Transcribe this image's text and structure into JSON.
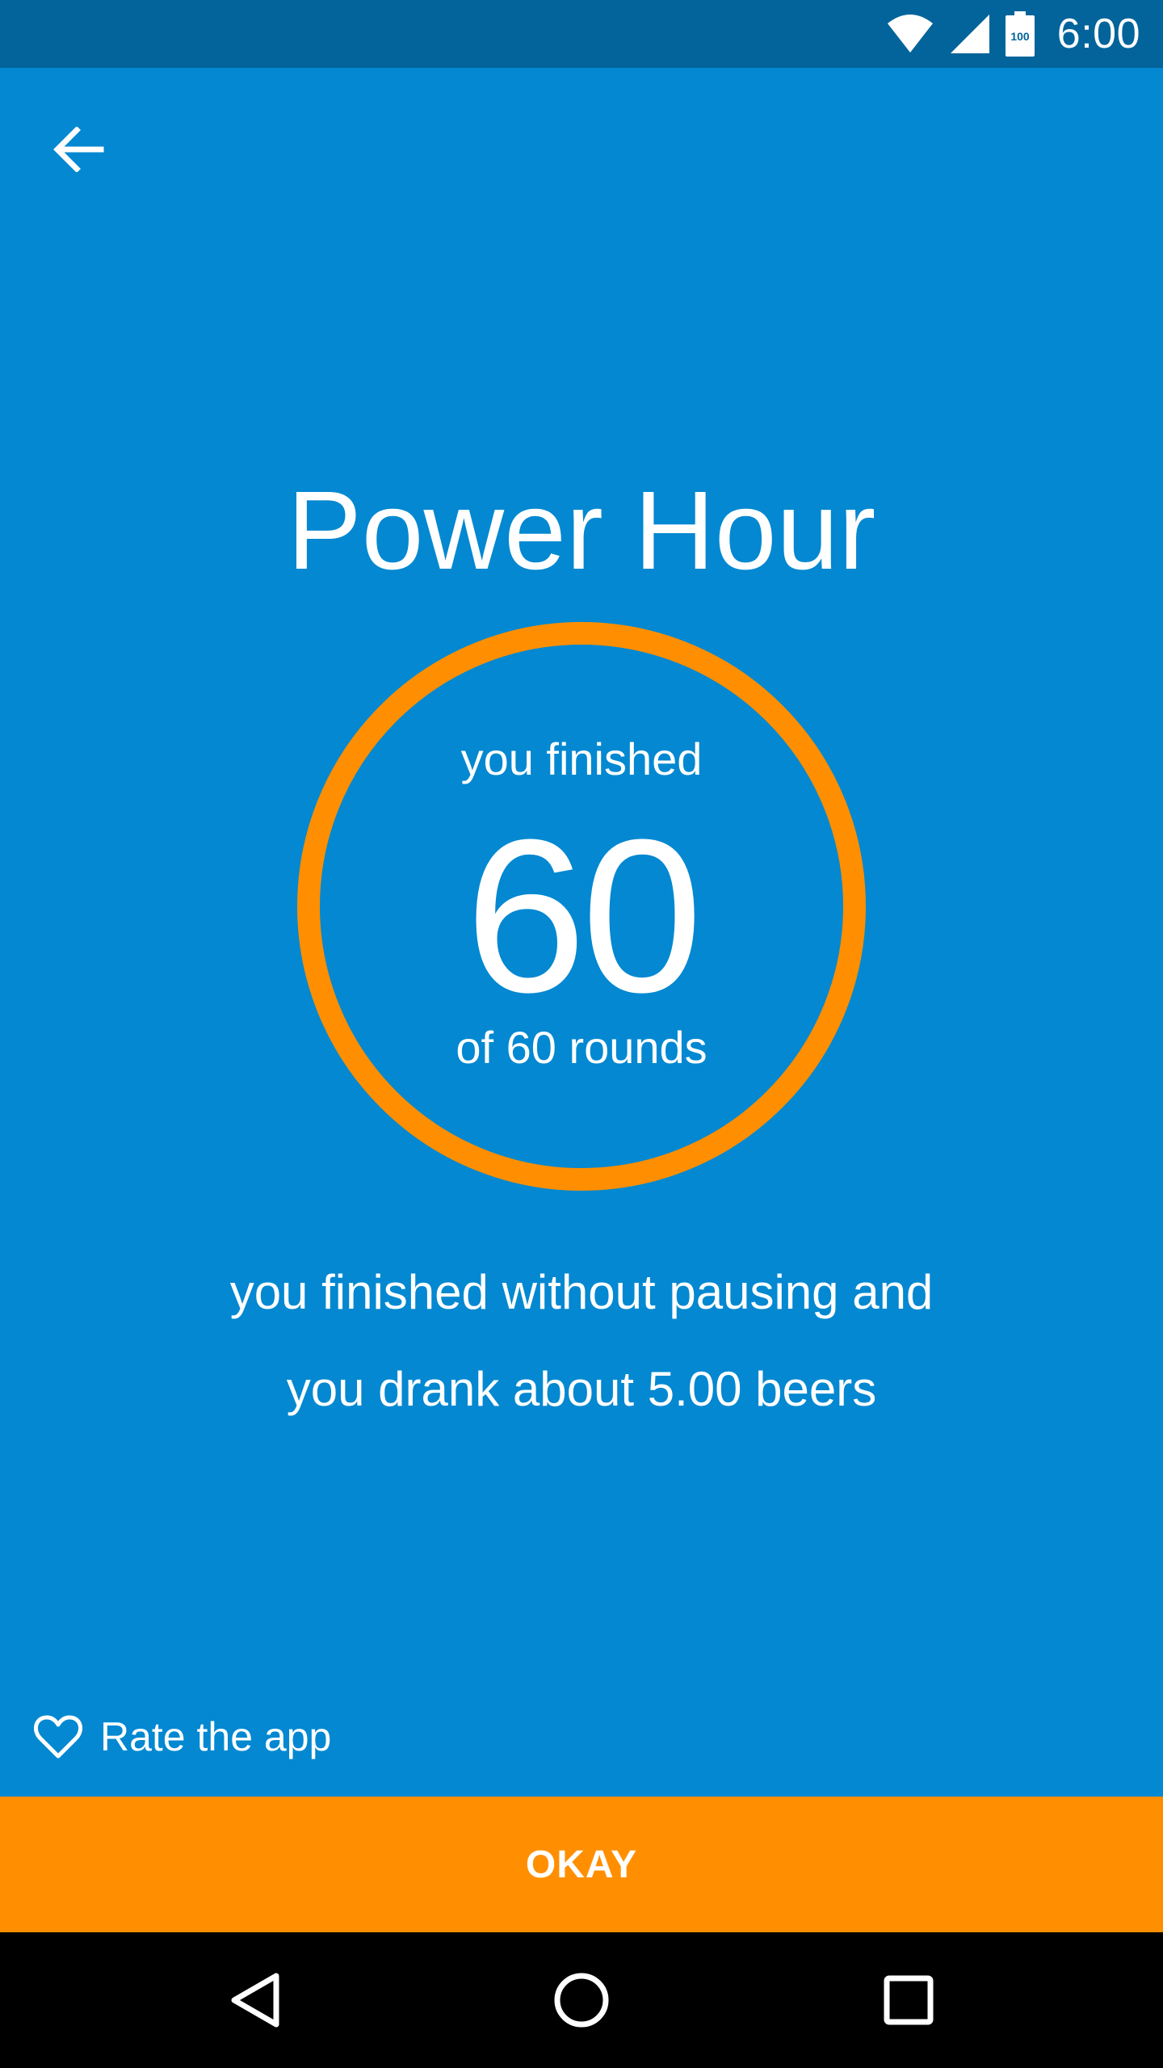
{
  "status_bar": {
    "time": "6:00",
    "battery_label": "100",
    "icons": [
      "wifi-icon",
      "cell-signal-icon",
      "battery-icon"
    ]
  },
  "toolbar": {
    "back_icon": "arrow-back-icon"
  },
  "main": {
    "title": "Power Hour",
    "ring": {
      "top_label": "you finished",
      "value": "60",
      "bottom_label": "of 60 rounds",
      "progress": 1.0
    },
    "summary_line1": "you finished without pausing and",
    "summary_line2": "you drank about 5.00 beers"
  },
  "footer": {
    "rate_icon": "heart-outline-icon",
    "rate_label": "Rate the app",
    "okay_label": "OKAY"
  },
  "nav_bar": {
    "icons": [
      "back-triangle-icon",
      "home-circle-icon",
      "recents-square-icon"
    ]
  },
  "colors": {
    "background": "#0388D1",
    "status_bar": "#02649B",
    "accent": "#FF8F00",
    "nav_bar": "#000000",
    "text": "#FFFFFF"
  }
}
